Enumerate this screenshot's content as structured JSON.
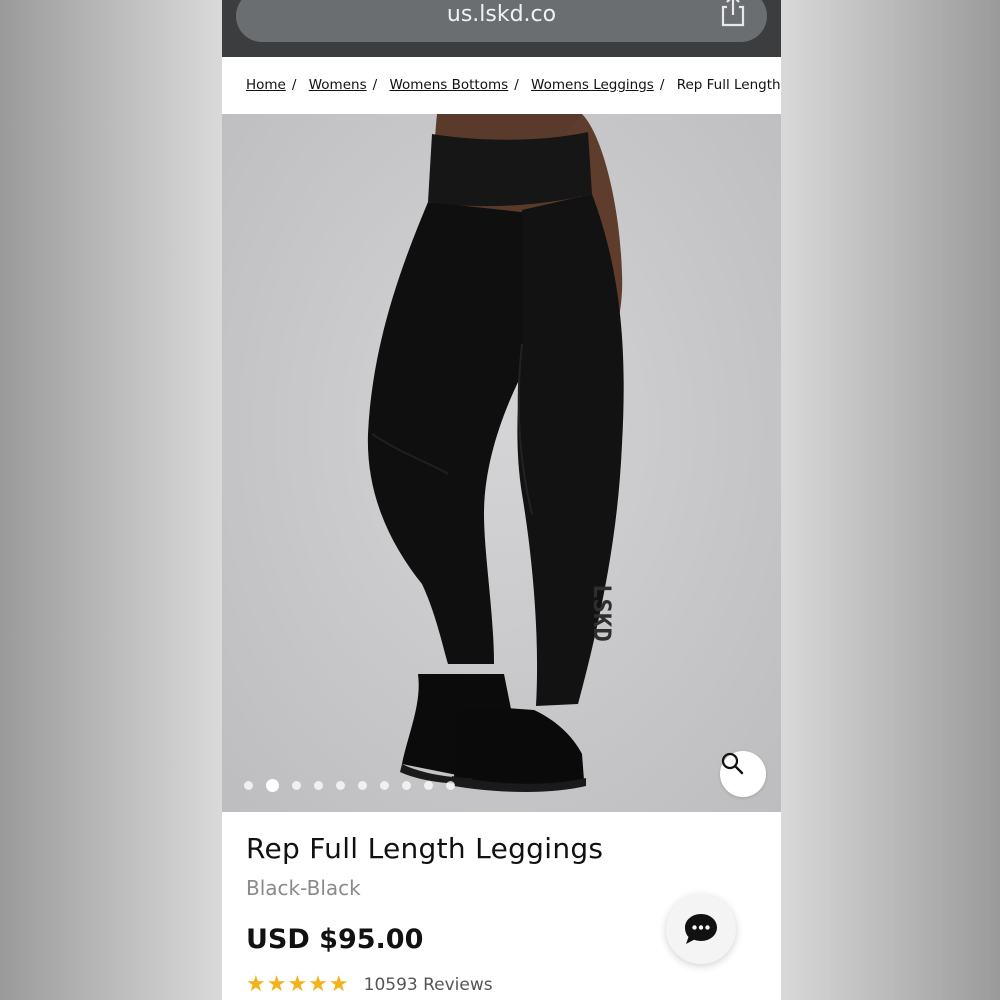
{
  "browser": {
    "url": "us.lskd.co",
    "share_icon": "share-icon"
  },
  "breadcrumb": {
    "items": [
      "Home",
      "Womens",
      "Womens Bottoms",
      "Womens Leggings"
    ],
    "separator": "/",
    "current": "Rep Full Length"
  },
  "gallery": {
    "image_count": 10,
    "active_index": 1,
    "zoom_icon": "magnifier-icon",
    "brand_print": "LSKD"
  },
  "product": {
    "title": "Rep Full Length Leggings",
    "colorway": "Black-Black",
    "price": "USD $95.00",
    "rating_stars": "★★★★★",
    "rating_value": 5,
    "reviews": "10593 Reviews"
  },
  "chat": {
    "icon": "chat-bubble-icon"
  },
  "colors": {
    "browser_bar": "#3b3d3f",
    "url_pill": "#6b6e71",
    "star": "#f2b21b",
    "text": "#111111",
    "muted": "#8a8a8a"
  }
}
